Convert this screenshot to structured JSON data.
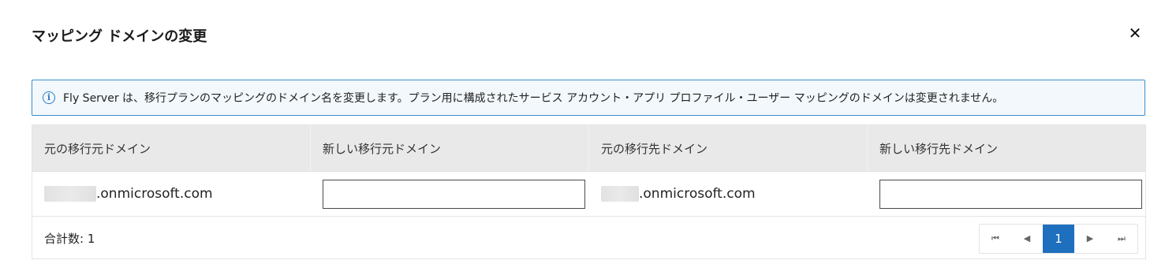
{
  "dialog": {
    "title": "マッピング ドメインの変更",
    "close_glyph": "✕"
  },
  "info": {
    "icon": "info-icon",
    "icon_glyph": "i",
    "message": "Fly Server は、移行プランのマッピングのドメイン名を変更します。プラン用に構成されたサービス アカウント・アプリ プロファイル・ユーザー マッピングのドメインは変更されません。"
  },
  "table": {
    "headers": [
      "元の移行元ドメイン",
      "新しい移行元ドメイン",
      "元の移行先ドメイン",
      "新しい移行先ドメイン"
    ],
    "rows": [
      {
        "source_domain_suffix": ".onmicrosoft.com",
        "new_source_domain_value": "",
        "target_domain_suffix": ".onmicrosoft.com",
        "new_target_domain_value": ""
      }
    ]
  },
  "footer": {
    "total_label": "合計数: 1"
  },
  "pagination": {
    "first_glyph": "⏮",
    "prev_glyph": "◀",
    "current_page": "1",
    "next_glyph": "▶",
    "last_glyph": "⏭"
  },
  "colors": {
    "info_border": "#3a8fd0",
    "info_background": "#f3f8fc",
    "header_background": "#e9e9e9",
    "active_page": "#1f6fbf"
  }
}
